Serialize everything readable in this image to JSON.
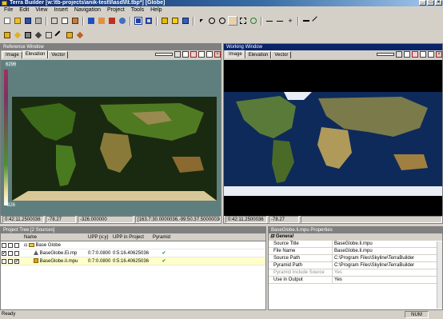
{
  "app": {
    "title": "Terra Builder [w:\\tb-projects\\anik-test\\I\\asd\\I\\t.tbp*] [Globe]"
  },
  "menu": [
    "File",
    "Edit",
    "View",
    "Insert",
    "Navigation",
    "Project",
    "Tools",
    "Help"
  ],
  "reference": {
    "title": "Reference Window",
    "tabs": [
      "Image",
      "Elevation",
      "Vector"
    ],
    "active_tab": "Elevation",
    "scale_max": "6296",
    "scale_min": "-326",
    "status": [
      "0:42:11.2500036",
      "-78.27",
      "-326.000000",
      "[163.7:30.0000036,-99:50.37.50000036]"
    ]
  },
  "working": {
    "title": "Working Window",
    "tabs": [
      "Image",
      "Elevation",
      "Vector"
    ],
    "active_tab": "Image",
    "status": [
      "0:42:11.2500036",
      "-78.27"
    ]
  },
  "tree": {
    "title": "Project Tree [2 Sources]",
    "columns": [
      "Name",
      "UPP (x:y)",
      "UPP in Project",
      "Pyramid"
    ],
    "rows": [
      {
        "name": "Base Globe",
        "upp": "",
        "upp_proj": "",
        "pyramid": "",
        "level": 0,
        "checks": [
          "",
          "",
          ""
        ]
      },
      {
        "name": "BaseGlobe.Ei.mp",
        "upp": "0:7:0.0800",
        "upp_proj": "0:5:16.40625036",
        "pyramid": "✔",
        "level": 1,
        "checks": [
          "✔",
          "",
          ""
        ]
      },
      {
        "name": "BaseGlobe.Ii.mpu",
        "upp": "0:7:0.0800",
        "upp_proj": "0:5:16.40625036",
        "pyramid": "✔",
        "level": 1,
        "checks": [
          "",
          "",
          "✔"
        ]
      }
    ]
  },
  "props": {
    "title": "BaseGlobe.Ii.mpu Properties",
    "section": "General",
    "rows": [
      {
        "k": "Source Title",
        "v": "BaseGlobe.Ii.mpu"
      },
      {
        "k": "File Name",
        "v": "BaseGlobe.Ii.mpu"
      },
      {
        "k": "Source Path",
        "v": "C:\\Program Files\\Skyline\\TerraBuilder"
      },
      {
        "k": "Pyramid Path",
        "v": "C:\\Program Files\\Skyline\\TerraBuilder"
      },
      {
        "k": "Pyramid Include Source",
        "v": "Yes"
      },
      {
        "k": "Use in Output",
        "v": "Yes"
      }
    ]
  },
  "statusbar": {
    "left": "Ready",
    "right": "NUM"
  }
}
